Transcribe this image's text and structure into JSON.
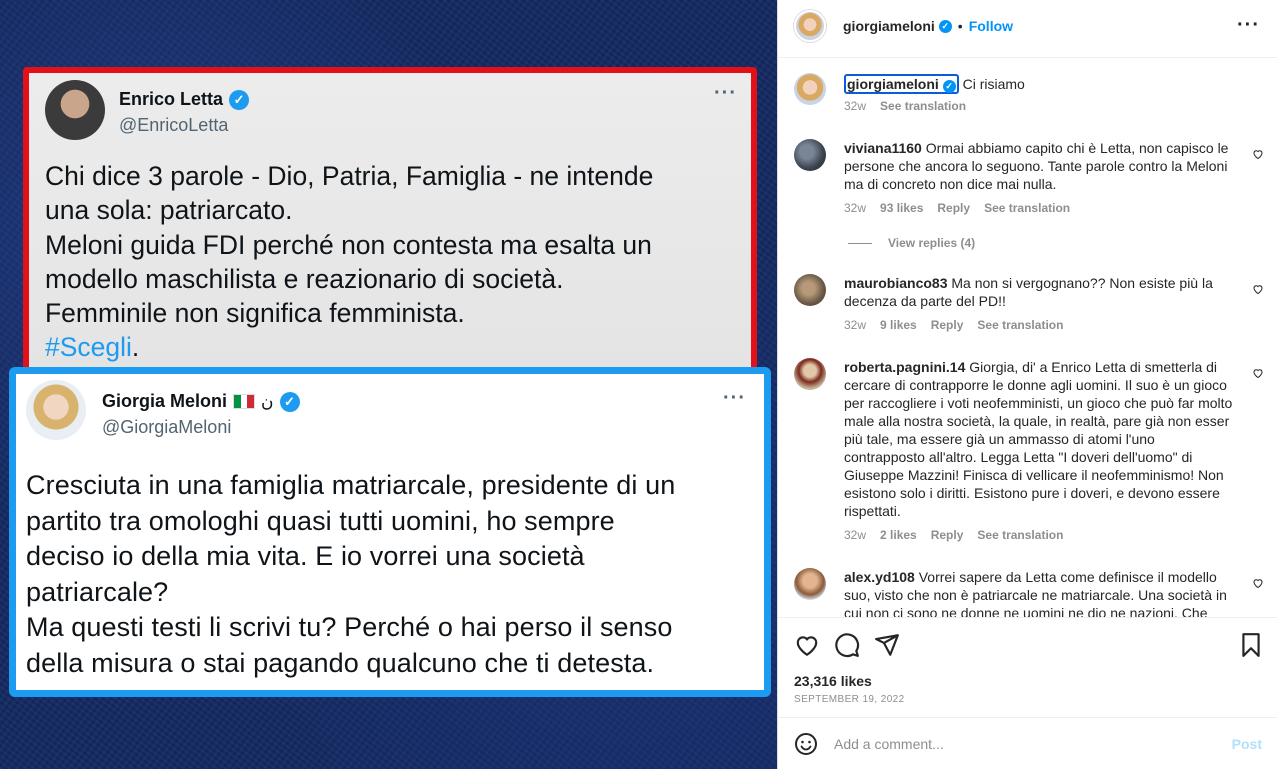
{
  "post_image": {
    "tweet_letta": {
      "name": "Enrico Letta",
      "handle": "@EnricoLetta",
      "more": "···",
      "lines": [
        "Chi dice 3 parole - Dio, Patria, Famiglia - ne intende",
        "una sola: patriarcato.",
        "Meloni guida FDI perché non contesta ma esalta un",
        "modello maschilista e reazionario di società.",
        "Femminile non significa femminista."
      ],
      "hashtag": "#Scegli",
      "hashtag_suffix": "."
    },
    "tweet_meloni": {
      "name": "Giorgia Meloni",
      "name_extra": "ن",
      "handle": "@GiorgiaMeloni",
      "more": "···",
      "lines": [
        "Cresciuta in una famiglia matriarcale, presidente di un",
        "partito tra omologhi quasi tutti uomini, ho sempre",
        "deciso io della mia vita. E io vorrei una società",
        "patriarcale?",
        "Ma questi testi li scrivi tu? Perché o hai perso il senso",
        "della misura o stai pagando qualcuno che ti detesta."
      ]
    }
  },
  "header": {
    "username": "giorgiameloni",
    "dot": "•",
    "follow": "Follow",
    "more": "···"
  },
  "caption": {
    "username": "giorgiameloni",
    "text": "Ci risiamo",
    "time": "32w",
    "see_translation": "See translation"
  },
  "comments": [
    {
      "username": "viviana1160",
      "text": "Ormai abbiamo capito chi è Letta, non capisco le persone che ancora lo seguono. Tante parole contro la Meloni ma di concreto non dice mai nulla.",
      "time": "32w",
      "likes": "93 likes",
      "reply": "Reply",
      "see_translation": "See translation",
      "view_replies": "View replies (4)"
    },
    {
      "username": "maurobianco83",
      "text": "Ma non si vergognano?? Non esiste più la decenza da parte del PD!!",
      "time": "32w",
      "likes": "9 likes",
      "reply": "Reply",
      "see_translation": "See translation"
    },
    {
      "username": "roberta.pagnini.14",
      "text": "Giorgia, di' a Enrico Letta di smetterla di cercare di contrapporre le donne agli uomini. Il suo è un gioco per raccogliere i voti neofemministi, un gioco che può far molto male alla nostra società, la quale, in realtà, pare già non esser più tale, ma essere già un ammasso di atomi l'uno contrapposto all'altro. Legga Letta \"I doveri dell'uomo\" di Giuseppe Mazzini! Finisca di vellicare il neofemminismo! Non esistono solo i diritti. Esistono pure i doveri, e devono essere rispettati.",
      "time": "32w",
      "likes": "2 likes",
      "reply": "Reply",
      "see_translation": "See translation"
    },
    {
      "username": "alex.yd108",
      "text": "Vorrei sapere da Letta come definisce il modello suo, visto che non è patriarcale ne matriarcale. Una società in cui non ci sono ne donne ne uomini ne dio ne nazioni. Che"
    }
  ],
  "actions": {
    "likes": "23,316 likes",
    "date": "SEPTEMBER 19, 2022"
  },
  "add_comment": {
    "placeholder": "Add a comment...",
    "post": "Post"
  },
  "colors": {
    "letta_border": "#e3101a",
    "meloni_border": "#1d9bf0",
    "ig_blue": "#0095f6",
    "background": "#142a63"
  }
}
